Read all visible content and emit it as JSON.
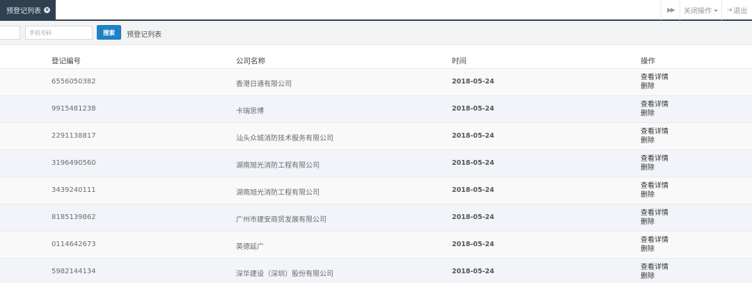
{
  "tabs": {
    "active_label": "预登记列表",
    "forward_glyph": "▶▶",
    "close_ops_label": "关闭操作",
    "logout_label": "退出"
  },
  "search": {
    "phone_placeholder": "手机号码",
    "search_label": "搜索",
    "list_title": "预登记列表"
  },
  "table": {
    "headers": {
      "id": "登记编号",
      "company": "公司名称",
      "time": "时间",
      "ops": "操作"
    },
    "op_detail": "查看详情",
    "op_delete": "删除",
    "rows": [
      {
        "id": "6556050382",
        "company": "香港日通有限公司",
        "time": "2018-05-24"
      },
      {
        "id": "9915481238",
        "company": "卡瑞思博",
        "time": "2018-05-24"
      },
      {
        "id": "2291138817",
        "company": "汕头众城消防技术服务有限公司",
        "time": "2018-05-24"
      },
      {
        "id": "3196490560",
        "company": "湖南旭光消防工程有限公司",
        "time": "2018-05-24"
      },
      {
        "id": "3439240111",
        "company": "湖南旭光消防工程有限公司",
        "time": "2018-05-24"
      },
      {
        "id": "8185139862",
        "company": "广州市建安商贸发展有限公司",
        "time": "2018-05-24"
      },
      {
        "id": "0114642673",
        "company": "英德延广",
        "time": "2018-05-24"
      },
      {
        "id": "5982144134",
        "company": "深华建设（深圳）股份有限公司",
        "time": "2018-05-24"
      }
    ]
  },
  "colors": {
    "tab_bg": "#2f4050",
    "search_button": "#1c84c6",
    "row_alt": "#f2f4f9"
  }
}
